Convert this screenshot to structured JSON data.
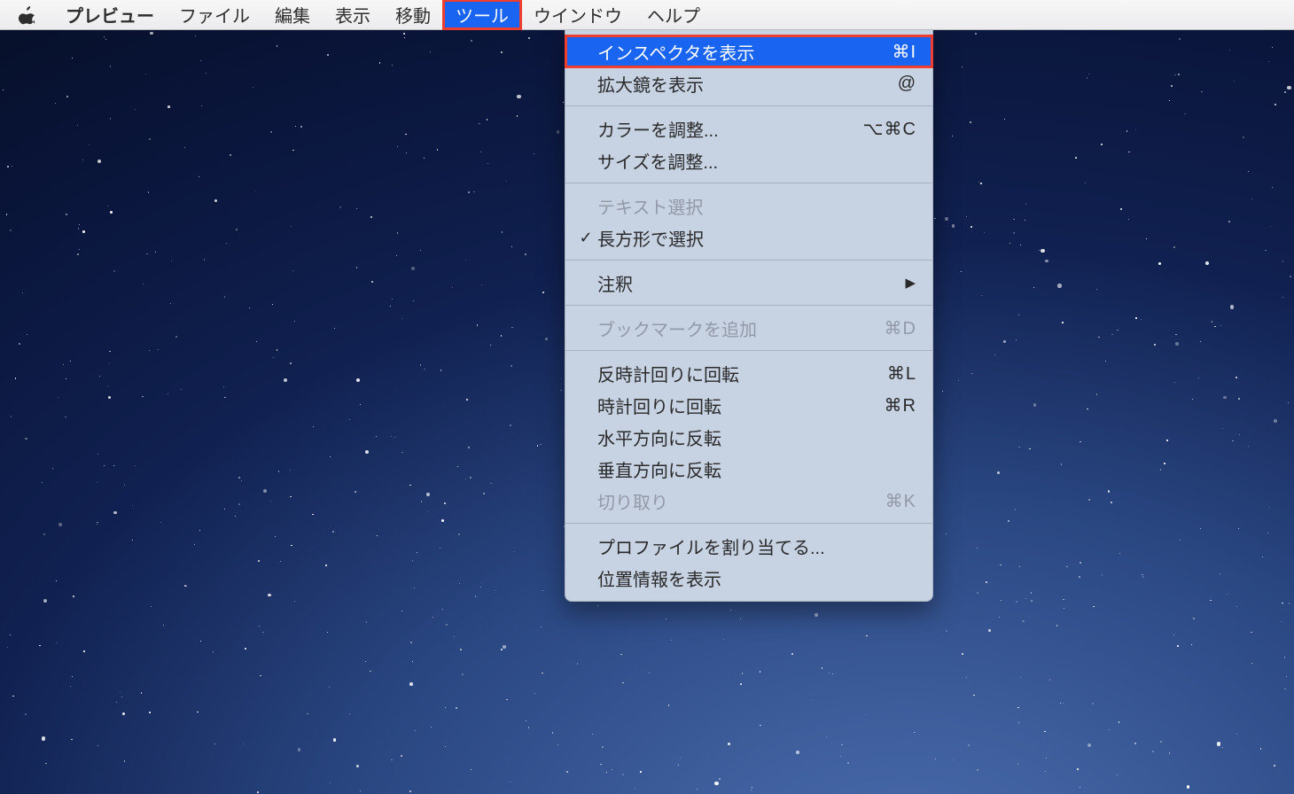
{
  "menubar": {
    "items": [
      {
        "label": "プレビュー",
        "kind": "app"
      },
      {
        "label": "ファイル"
      },
      {
        "label": "編集"
      },
      {
        "label": "表示"
      },
      {
        "label": "移動"
      },
      {
        "label": "ツール",
        "active": true
      },
      {
        "label": "ウインドウ"
      },
      {
        "label": "ヘルプ"
      }
    ]
  },
  "dropdown": {
    "groups": [
      [
        {
          "label": "インスペクタを表示",
          "shortcut": "⌘I",
          "selected": true
        },
        {
          "label": "拡大鏡を表示",
          "shortcut": "@"
        }
      ],
      [
        {
          "label": "カラーを調整...",
          "shortcut": "⌥⌘C"
        },
        {
          "label": "サイズを調整..."
        }
      ],
      [
        {
          "label": "テキスト選択",
          "disabled": true
        },
        {
          "label": "長方形で選択",
          "checked": true
        }
      ],
      [
        {
          "label": "注釈",
          "submenu": true
        }
      ],
      [
        {
          "label": "ブックマークを追加",
          "shortcut": "⌘D",
          "disabled": true
        }
      ],
      [
        {
          "label": "反時計回りに回転",
          "shortcut": "⌘L"
        },
        {
          "label": "時計回りに回転",
          "shortcut": "⌘R"
        },
        {
          "label": "水平方向に反転"
        },
        {
          "label": "垂直方向に反転"
        },
        {
          "label": "切り取り",
          "shortcut": "⌘K",
          "disabled": true
        }
      ],
      [
        {
          "label": "プロファイルを割り当てる..."
        },
        {
          "label": "位置情報を表示"
        }
      ]
    ]
  },
  "checkmark": "✓",
  "arrow": "▶"
}
